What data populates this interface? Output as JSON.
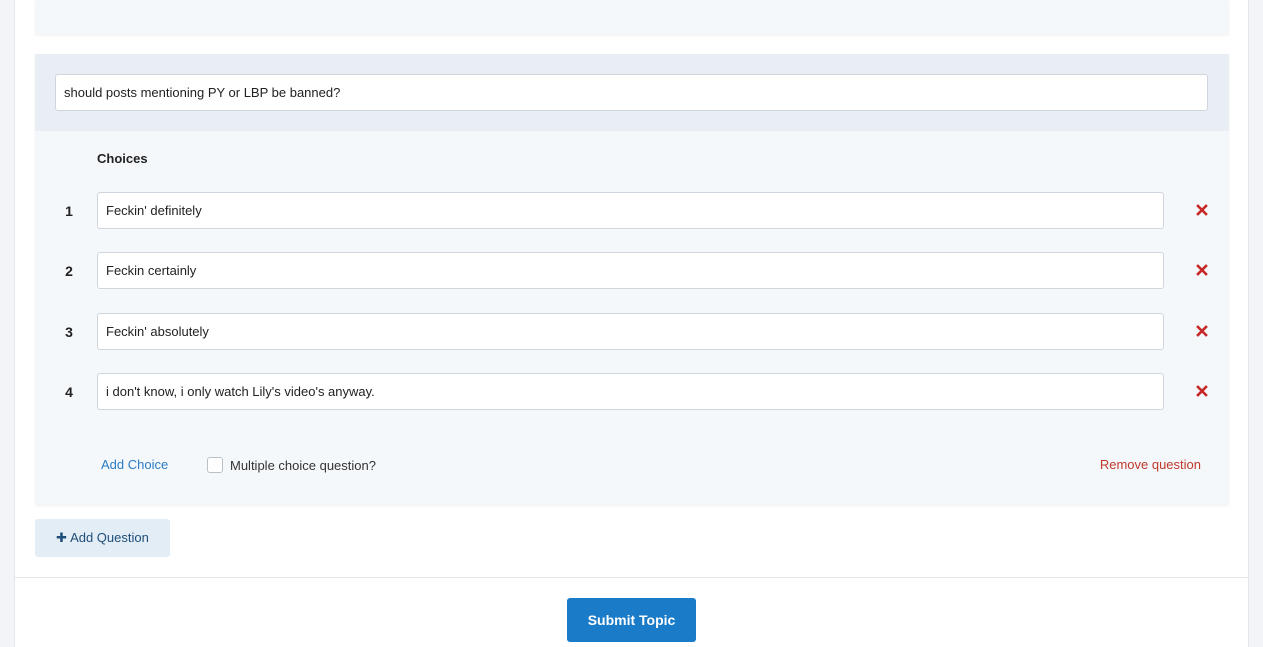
{
  "question": {
    "text": "should posts mentioning PY or LBP be banned?",
    "choices_title": "Choices",
    "choices": [
      {
        "num": "1",
        "value": "Feckin' definitely"
      },
      {
        "num": "2",
        "value": "Feckin certainly"
      },
      {
        "num": "3",
        "value": "Feckin' absolutely"
      },
      {
        "num": "4",
        "value": "i don't know, i only watch Lily's video's anyway."
      }
    ],
    "add_choice_label": "Add Choice",
    "multiple_choice_label": "Multiple choice question?",
    "multiple_choice_checked": false,
    "remove_question_label": "Remove question"
  },
  "actions": {
    "add_question_label": "Add Question",
    "submit_label": "Submit Topic"
  },
  "colors": {
    "accent": "#1a7bc9",
    "link": "#2b7bc5",
    "danger": "#c0392b",
    "remove_icon": "#c62828"
  },
  "icons": {
    "remove_choice": "close-icon",
    "add_question": "plus-icon"
  }
}
